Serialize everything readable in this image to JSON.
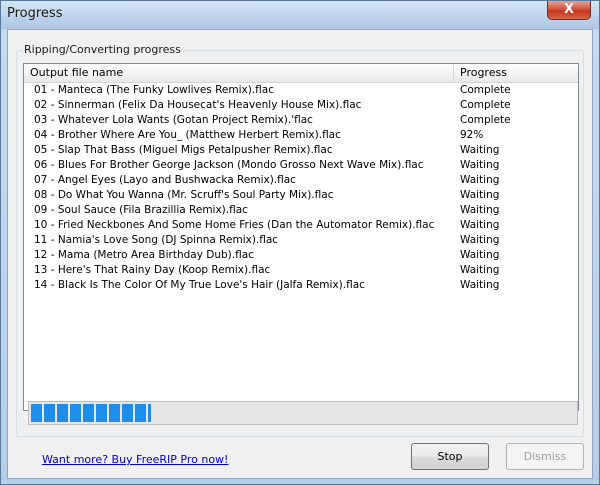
{
  "window": {
    "title": "Progress",
    "close_glyph": "X"
  },
  "group": {
    "label": "Ripping/Converting progress"
  },
  "list": {
    "columns": [
      "Output file name",
      "Progress"
    ],
    "rows": [
      {
        "name": "01 - Manteca (The Funky Lowlives Remix).flac",
        "progress": "Complete"
      },
      {
        "name": "02 - Sinnerman (Felix Da Housecat's Heavenly House Mix).flac",
        "progress": "Complete"
      },
      {
        "name": "03 - Whatever Lola Wants (Gotan Project Remix).'flac",
        "progress": "Complete"
      },
      {
        "name": "04 - Brother Where Are You_ (Matthew Herbert Remix).flac",
        "progress": "92%"
      },
      {
        "name": "05 - Slap That Bass (Miguel Migs Petalpusher Remix).flac",
        "progress": "Waiting"
      },
      {
        "name": "06 - Blues For Brother George Jackson (Mondo Grosso Next Wave Mix).flac",
        "progress": "Waiting"
      },
      {
        "name": "07 - Angel Eyes (Layo and Bushwacka Remix).flac",
        "progress": "Waiting"
      },
      {
        "name": "08 - Do What You Wanna (Mr. Scruff's Soul Party Mix).flac",
        "progress": "Waiting"
      },
      {
        "name": "09 - Soul Sauce (Fila Brazillia Remix).flac",
        "progress": "Waiting"
      },
      {
        "name": "10 - Fried Neckbones And Some Home Fries (Dan the Automator Remix).flac",
        "progress": "Waiting"
      },
      {
        "name": "11 - Namia's Love Song (DJ Spinna Remix).flac",
        "progress": "Waiting"
      },
      {
        "name": "12 - Mama (Metro Area Birthday Dub).flac",
        "progress": "Waiting"
      },
      {
        "name": "13 - Here's That Rainy Day (Koop Remix).flac",
        "progress": "Waiting"
      },
      {
        "name": "14 - Black Is The Color Of My True Love's Hair (Jalfa Remix).flac",
        "progress": "Waiting"
      }
    ]
  },
  "progress": {
    "fraction": 0.22,
    "color": "#1e8de8"
  },
  "footer": {
    "link_text": "Want more? Buy FreeRIP Pro now!",
    "stop_label": "Stop",
    "dismiss_label": "Dismiss"
  }
}
